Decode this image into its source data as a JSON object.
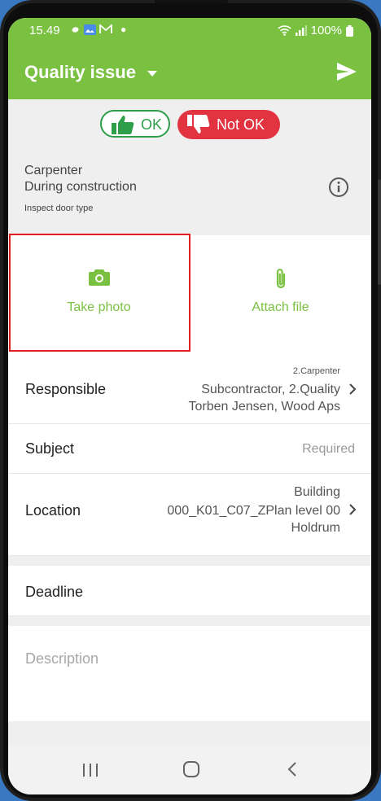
{
  "status_bar": {
    "time": "15.49",
    "battery": "100%"
  },
  "header": {
    "title": "Quality issue"
  },
  "verdict": {
    "ok_label": "OK",
    "not_ok_label": "Not OK"
  },
  "info": {
    "line1": "Carpenter",
    "line2": "During construction",
    "line3": "Inspect door type"
  },
  "attachments": {
    "photo_label": "Take photo",
    "file_label": "Attach file"
  },
  "responsible": {
    "label": "Responsible",
    "line1": "2.Carpenter",
    "line2": "Subcontractor, 2.Quality",
    "line3": "Torben Jensen, Wood Aps"
  },
  "subject": {
    "label": "Subject",
    "placeholder": "Required"
  },
  "location": {
    "label": "Location",
    "line1": "Building",
    "line2": "000_K01_C07_ZPlan level 00",
    "line3": "Holdrum"
  },
  "deadline": {
    "label": "Deadline"
  },
  "description": {
    "placeholder": "Description"
  },
  "colors": {
    "accent": "#7ac142",
    "ok": "#2e9e4a",
    "not_ok": "#e23440",
    "highlight": "#e02020"
  },
  "icons": [
    "gear-icon",
    "photos-icon",
    "gmail-icon",
    "wifi-icon",
    "signal-icon",
    "battery-icon",
    "dropdown-caret-icon",
    "send-icon",
    "thumbs-up-icon",
    "thumbs-down-icon",
    "info-icon",
    "camera-icon",
    "paperclip-icon",
    "chevron-right-icon",
    "recents-icon",
    "home-icon",
    "back-icon"
  ]
}
